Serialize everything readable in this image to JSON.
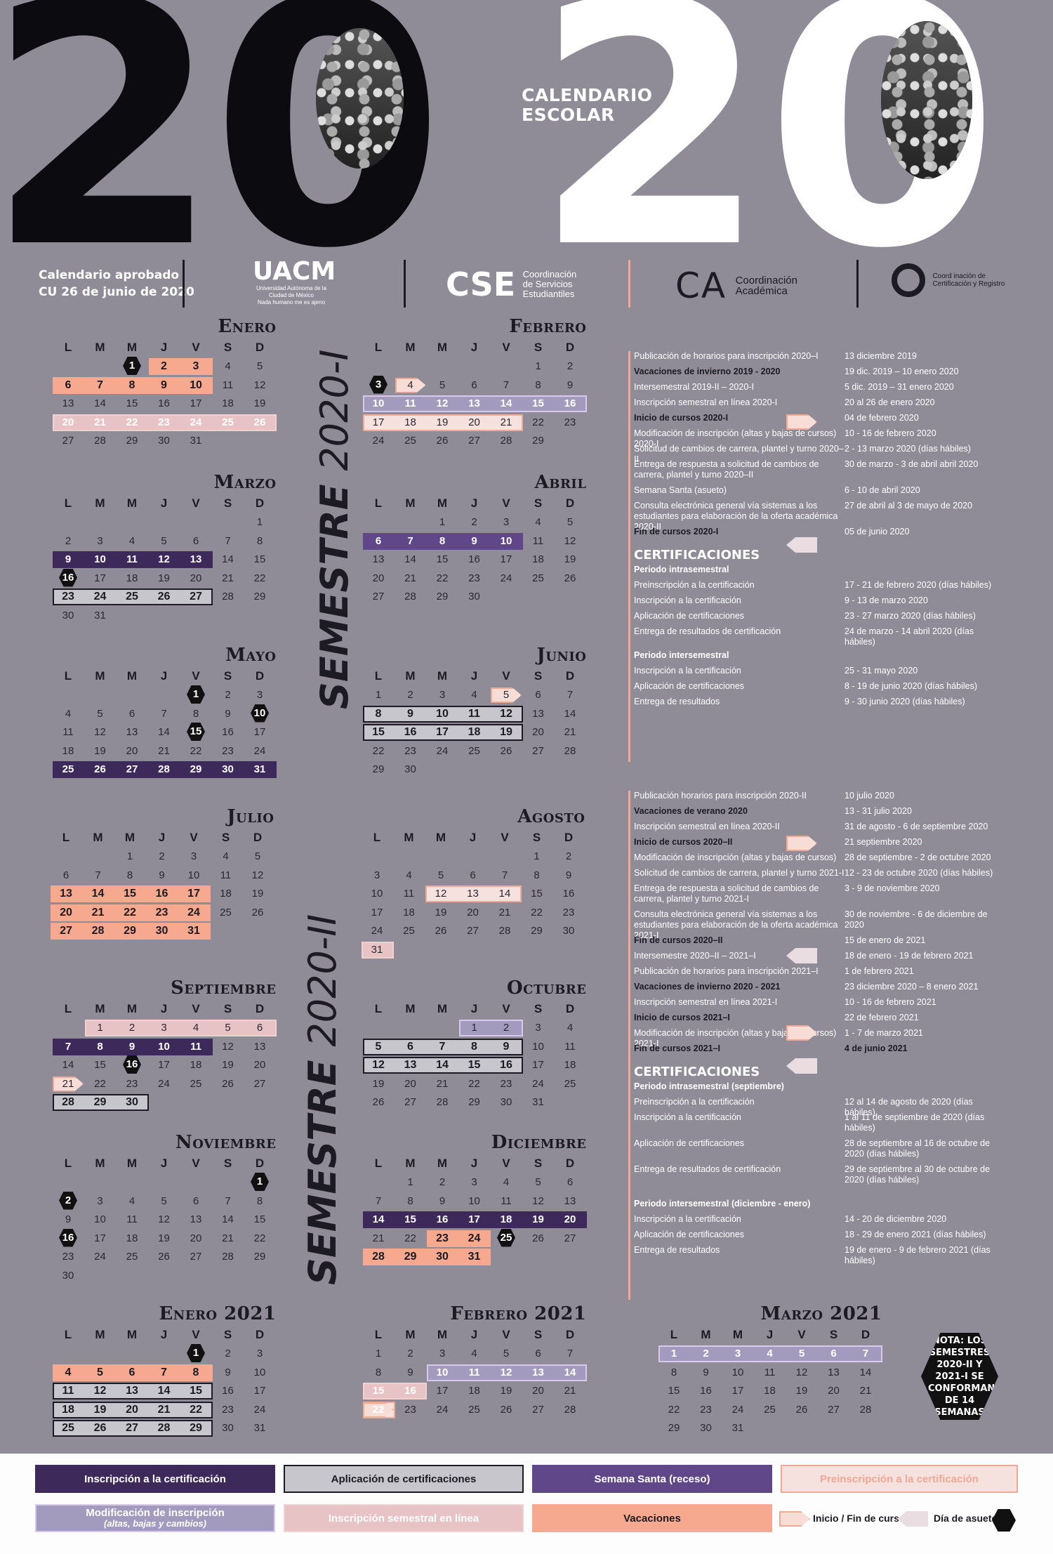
{
  "header": {
    "year_digits": [
      "2",
      "0",
      "2",
      "0"
    ],
    "title_line1": "CALENDARIO",
    "title_line2": "ESCOLAR",
    "approved_line1": "Calendario aprobado",
    "approved_line2": "CU 26 de junio de 2020",
    "uacm_name": "UACM",
    "uacm_full": "Universidad Autónoma de la Ciudad de México",
    "uacm_motto": "Nada humano me es ajeno",
    "cse_mark": "CSE",
    "cse_name_1": "Coordinación",
    "cse_name_2": "de Servicios",
    "cse_name_3": "Estudiantiles",
    "ca_mark": "CA",
    "ca_name_1": "Coordinación",
    "ca_name_2": "Académica",
    "ccr_name": "Coord inación de Certificación y Registro"
  },
  "semesters": {
    "s1_bold": "SEMESTRE",
    "s1_thin": "2020-I",
    "s2_bold": "SEMESTRE",
    "s2_thin": "2020-II"
  },
  "weekdays": [
    "L",
    "M",
    "M",
    "J",
    "V",
    "S",
    "D"
  ],
  "months": [
    {
      "name": "Enero",
      "start": 2,
      "days": 31
    },
    {
      "name": "Febrero",
      "start": 5,
      "days": 29
    },
    {
      "name": "Marzo",
      "start": 6,
      "days": 31
    },
    {
      "name": "Abril",
      "start": 2,
      "days": 30
    },
    {
      "name": "Mayo",
      "start": 4,
      "days": 31
    },
    {
      "name": "Junio",
      "start": 0,
      "days": 30
    },
    {
      "name": "Julio",
      "start": 2,
      "days": 31
    },
    {
      "name": "Agosto",
      "start": 5,
      "days": 31
    },
    {
      "name": "Septiembre",
      "start": 1,
      "days": 30
    },
    {
      "name": "Octubre",
      "start": 3,
      "days": 31
    },
    {
      "name": "Noviembre",
      "start": 6,
      "days": 30
    },
    {
      "name": "Diciembre",
      "start": 1,
      "days": 31
    },
    {
      "name": "Enero 2021",
      "start": 4,
      "days": 31
    },
    {
      "name": "Febrero 2021",
      "start": 0,
      "days": 28
    },
    {
      "name": "Marzo 2021",
      "start": 0,
      "days": 31
    }
  ],
  "info_block_1": {
    "rows": [
      {
        "label": "Publicación de horarios para inscripción 2020–I",
        "value": "13 diciembre 2019"
      },
      {
        "label": "Vacaciones de invierno 2019 - 2020",
        "value": "19 dic. 2019 – 10 enero 2020",
        "bold": true
      },
      {
        "label": "Intersemestral 2019-II – 2020-I",
        "value": "5 dic. 2019 – 31 enero 2020"
      },
      {
        "label": "Inscripción semestral en línea 2020-I",
        "value": "20 al 26 de enero 2020"
      },
      {
        "label": "Inicio de cursos 2020-I",
        "value": "04 de febrero 2020",
        "bold": true
      },
      {
        "label": "Modificación de inscripción (altas y bajas de cursos) 2020-I",
        "value": "10 - 16 de febrero 2020"
      },
      {
        "label": "Solicitud de cambios de carrera, plantel y turno 2020–II",
        "value": "2 - 13 marzo 2020 (días hábiles)"
      },
      {
        "label": "Entrega de respuesta a solicitud de cambios de carrera, plantel y turno 2020–II",
        "value": "30 de marzo - 3 de abril abril 2020"
      },
      {
        "label": "Semana Santa (asueto)",
        "value": "6 - 10 de abril 2020"
      },
      {
        "label": "Consulta electrónica general vía sistemas a los estudiantes para elaboración de la oferta académica 2020-II",
        "value": "27 de abril al 3 de mayo de 2020"
      },
      {
        "label": "Fin de cursos 2020-I",
        "value": "05 de junio 2020",
        "bold": true
      }
    ],
    "cert_title": "CERTIFICACIONES",
    "period1_title": "Periodo intrasemestral",
    "period1_rows": [
      {
        "label": "Preinscripción a la certificación",
        "value": "17 - 21 de febrero 2020 (días hábiles)"
      },
      {
        "label": "Inscripción a la certificación",
        "value": "9 - 13 de marzo 2020"
      },
      {
        "label": "Aplicación de certificaciones",
        "value": "23 - 27 marzo 2020 (días hábiles)"
      },
      {
        "label": "Entrega de resultados de certificación",
        "value": "24 de marzo - 14 abril 2020 (días hábiles)"
      }
    ],
    "period2_title": "Periodo intersemestral",
    "period2_rows": [
      {
        "label": "Inscripción a la certificación",
        "value": "25 - 31 mayo 2020"
      },
      {
        "label": "Aplicación de certificaciones",
        "value": "8 - 19 de junio 2020 (días hábiles)"
      },
      {
        "label": "Entrega de resultados",
        "value": "9 - 30 junio 2020 (días hábiles)"
      }
    ]
  },
  "info_block_2": {
    "rows": [
      {
        "label": "Publicación horarios para inscripción 2020-II",
        "value": "10 julio 2020"
      },
      {
        "label": "Vacaciones de verano 2020",
        "value": "13 - 31 julio 2020",
        "bold": true
      },
      {
        "label": "Inscripción semestral en línea 2020-II",
        "value": "31 de agosto - 6 de septiembre 2020"
      },
      {
        "label": "Inicio de cursos 2020–II",
        "value": "21 septiembre 2020",
        "bold": true
      },
      {
        "label": "Modificación de inscripción (altas y bajas de cursos)",
        "value": "28 de septiembre - 2 de octubre 2020"
      },
      {
        "label": "Solicitud de cambios de carrera, plantel y turno 2021-I",
        "value": "12 - 23 de octubre 2020 (días hábiles)"
      },
      {
        "label": "Entrega de respuesta a solicitud de cambios de carrera, plantel y turno 2021-I",
        "value": "3 - 9 de noviembre 2020"
      },
      {
        "label": "Consulta electrónica general vía sistemas a los estudiantes para elaboración de la oferta académica 2021-I",
        "value": "30 de noviembre - 6 de diciembre de 2020"
      },
      {
        "label": "Fin de cursos 2020–II",
        "value": "15 de enero de 2021",
        "bold": true
      },
      {
        "label": "Intersemestre 2020–II – 2021–I",
        "value": "18 de enero - 19 de febrero 2021"
      },
      {
        "label": "Publicación de horarios para inscripción 2021–I",
        "value": "1 de febrero 2021"
      },
      {
        "label": "Vacaciones de invierno 2020 - 2021",
        "value": "23 diciembre 2020 – 8 enero 2021",
        "bold": true
      },
      {
        "label": "Inscripción semestral en línea 2021-I",
        "value": "10 - 16 de febrero 2021"
      },
      {
        "label": "Inicio de cursos 2021–I",
        "value": "22 de febrero 2021",
        "bold": true
      },
      {
        "label": "Modificación de inscripción (altas y bajas de cursos) 2021-I",
        "value": "1 - 7 de marzo 2021"
      },
      {
        "label": "Fin de cursos 2021–I",
        "value": "4 de junio 2021",
        "bold": true,
        "valbold": true
      }
    ],
    "cert_title": "CERTIFICACIONES",
    "period1_title": "Periodo intrasemestral (septiembre)",
    "period1_rows": [
      {
        "label": "Preinscripción a la certificación",
        "value": "12 al 14 de agosto de 2020 (días hábiles)"
      },
      {
        "label": "Inscripción a la certificación",
        "value": "1 al 11 de septiembre de 2020 (días hábiles)"
      },
      {
        "label": "Aplicación de certificaciones",
        "value": "28 de septiembre al 16 de octubre de 2020 (días hábiles)"
      },
      {
        "label": "Entrega de resultados de certificación",
        "value": "29 de septiembre al 30 de octubre de 2020 (días hábiles)"
      }
    ],
    "period2_title": "Periodo intersemestral (diciembre - enero)",
    "period2_rows": [
      {
        "label": "Inscripción a la certificación",
        "value": "14 - 20 de diciembre 2020"
      },
      {
        "label": "Aplicación de certificaciones",
        "value": "18 - 29 de enero 2021 (días hábiles)"
      },
      {
        "label": "Entrega de resultados",
        "value": "19 de enero - 9 de febrero 2021 (días hábiles)"
      }
    ]
  },
  "nota": "NOTA: LOS SEMESTRES 2020-II Y 2021-I SE CONFORMAN DE 14 SEMANAS",
  "legend": {
    "inscripcion_cert": "Inscripción a la certificación",
    "aplicacion_cert": "Aplicación de certificaciones",
    "semana_santa": "Semana Santa (receso)",
    "preinscripcion_cert": "Preinscripción a la certificación",
    "modificacion_1": "Modificación de inscripción",
    "modificacion_2": "(altas, bajas y cambios)",
    "inscripcion_linea": "Inscripción semestral en línea",
    "vacaciones": "Vacaciones",
    "inicio_fin": "Inicio / Fin de cursos",
    "dia_asueto": "Día de asueto"
  },
  "colors": {
    "background": "#8f8c98",
    "inscripcion_cert": "#3d2a5b",
    "aplicacion_cert": "#c7c6cc",
    "semana_santa": "#5f478a",
    "preinscripcion_cert": "#f5e1de",
    "modificacion": "#a39bbd",
    "inscripcion_linea": "#e8c3c5",
    "vacaciones": "#f6a98f"
  }
}
